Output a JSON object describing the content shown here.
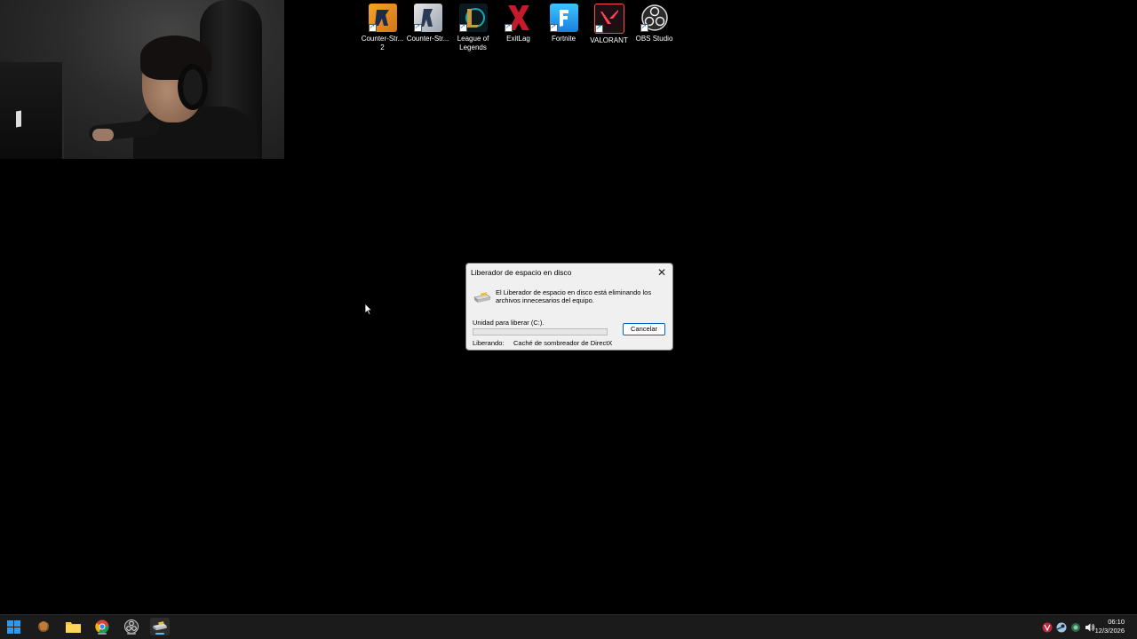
{
  "desktop": {
    "icons": [
      {
        "label": "Counter-Str... 2",
        "icon": "cs2-icon"
      },
      {
        "label": "Counter-Str...",
        "icon": "csgo-icon"
      },
      {
        "label": "League of Legends",
        "icon": "league-of-legends-icon"
      },
      {
        "label": "ExitLag",
        "icon": "exitlag-icon"
      },
      {
        "label": "Fortnite",
        "icon": "fortnite-icon"
      },
      {
        "label": "VALORANT",
        "icon": "valorant-icon"
      },
      {
        "label": "OBS Studio",
        "icon": "obs-studio-icon"
      }
    ]
  },
  "dialog": {
    "title": "Liberador de espacio en disco",
    "message": "El Liberador de espacio en disco está eliminando los archivos innecesarios del equipo.",
    "drive_label": "Unidad para liberar  (C:).",
    "cancel_label": "Cancelar",
    "freeing_label": "Liberando:",
    "freeing_value": "Caché de sombreador de DirectX",
    "progress": 0
  },
  "taskbar": {
    "apps": [
      "start-icon",
      "app-icon",
      "file-explorer-icon",
      "chrome-icon",
      "obs-icon",
      "disk-cleanup-icon"
    ],
    "tray": [
      "valorant-tray-icon",
      "steam-tray-icon",
      "network-tray-icon",
      "volume-icon"
    ],
    "time": "06:10",
    "date": "12/3/2026"
  },
  "colors": {
    "accent": "#0067c0",
    "taskbar": "#1b1b1b",
    "dialog_bg": "#f0f0f0"
  }
}
